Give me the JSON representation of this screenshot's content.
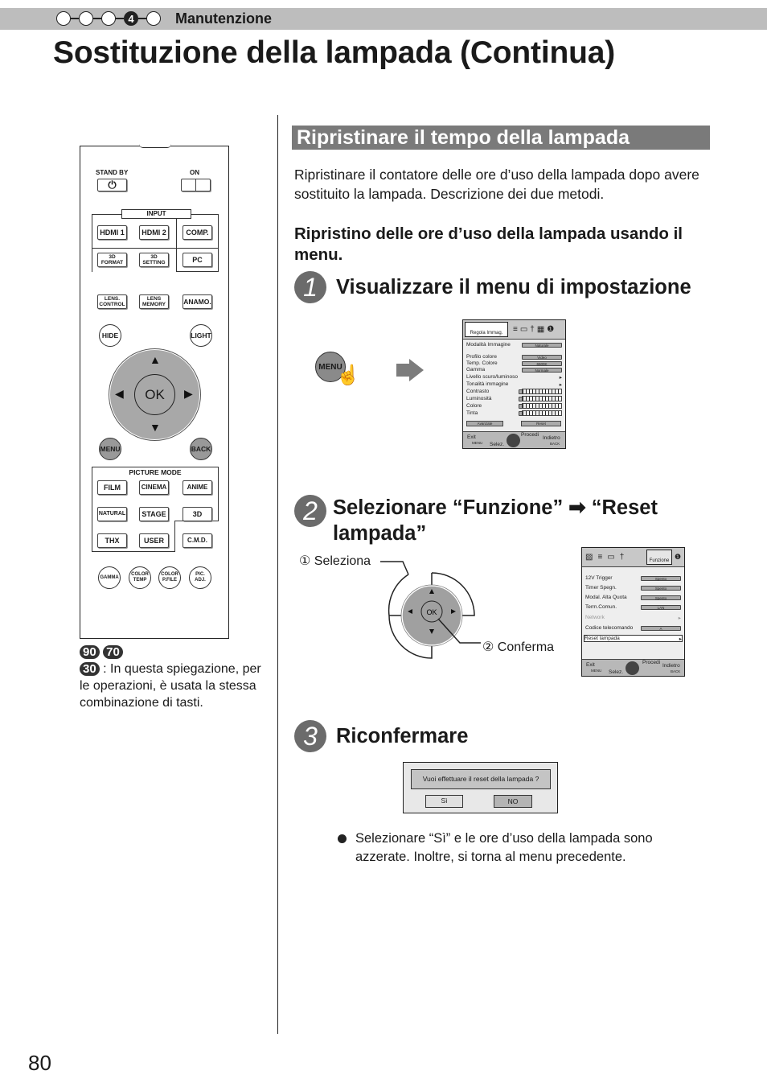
{
  "header": {
    "section_label": "Manutenzione",
    "step_indicator": {
      "total": 5,
      "current": 4,
      "current_label": "4"
    },
    "title": "Sostituzione della lampada (Continua)"
  },
  "page_number": "80",
  "remote": {
    "standby_label": "STAND BY",
    "on_label": "ON",
    "input_group_label": "INPUT",
    "input_buttons": [
      "HDMI 1",
      "HDMI 2",
      "COMP.",
      "PC"
    ],
    "format_buttons": [
      "3D FORMAT",
      "3D SETTING"
    ],
    "lens_buttons": [
      "LENS. CONTROL",
      "LENS MEMORY",
      "ANAMO."
    ],
    "hide_label": "HIDE",
    "light_label": "LIGHT",
    "ok_label": "OK",
    "menu_label": "MENU",
    "back_label": "BACK",
    "picture_mode_label": "PICTURE MODE",
    "picture_mode_buttons": [
      "FILM",
      "CINEMA",
      "ANIME",
      "NATURAL",
      "STAGE",
      "3D",
      "THX",
      "USER"
    ],
    "cmd_label": "C.M.D.",
    "bottom_buttons": [
      "GAMMA",
      "COLOR TEMP",
      "COLOR P.FILE",
      "PIC. ADJ."
    ]
  },
  "model_note": {
    "badges": [
      "90",
      "70",
      "30"
    ],
    "text": ": In questa spiegazione, per le operazioni, è usata la stessa combinazione di tasti."
  },
  "main": {
    "heading": "Ripristinare il tempo della lampada",
    "intro": "Ripristinare il contatore delle ore d’uso della lampada dopo avere sostituito la lampada. Descrizione dei due metodi.",
    "subheading": "Ripristino delle ore d’uso della lampada usando il menu.",
    "steps": [
      {
        "num": "1",
        "title": "Visualizzare il menu di impostazione"
      },
      {
        "num": "2",
        "title": "Selezionare “Funzione” ➡ “Reset lampada”"
      },
      {
        "num": "3",
        "title": "Riconfermare"
      }
    ],
    "menu_button_label": "MENU",
    "osd1": {
      "tab_label": "Regola Immag.",
      "rows": [
        {
          "label": "Modalità Immagine",
          "value": "Naturale"
        },
        {
          "label": "Profilo colore",
          "value": "Video"
        },
        {
          "label": "Temp. Colore",
          "value": "6500K"
        },
        {
          "label": "Gamma",
          "value": "Normale"
        },
        {
          "label": "Livello scuro/luminoso",
          "value": "▸"
        },
        {
          "label": "Tonalità immagine",
          "value": "▸"
        },
        {
          "label": "Contrasto",
          "value": "0"
        },
        {
          "label": "Luminosità",
          "value": "0"
        },
        {
          "label": "Colore",
          "value": "0"
        },
        {
          "label": "Tinta",
          "value": "0"
        }
      ],
      "advanced_label": "Avanzate",
      "reset_label": "Reset",
      "footer": {
        "exit": "Exit",
        "exit_key": "MENU",
        "select": "Selez.",
        "proceed": "Procedi",
        "back": "Indietro",
        "back_key": "BACK"
      }
    },
    "dpad_labels": {
      "select": "① Seleziona",
      "confirm": "② Conferma",
      "ok": "OK"
    },
    "osd2": {
      "tab_label": "Funzione",
      "rows": [
        {
          "label": "12V Trigger",
          "value": "Spento"
        },
        {
          "label": "Timer Spegn.",
          "value": "Spento"
        },
        {
          "label": "Modal. Alta Quota",
          "value": "Spento"
        },
        {
          "label": "Term.Comun.",
          "value": "LAN"
        },
        {
          "label": "Network",
          "value": "▸"
        },
        {
          "label": "Codice telecomando",
          "value": "A"
        },
        {
          "label": "Reset lampada",
          "value": "▸"
        }
      ],
      "footer": {
        "exit": "Exit",
        "exit_key": "MENU",
        "select": "Selez.",
        "proceed": "Procedi",
        "back": "Indietro",
        "back_key": "BACK"
      }
    },
    "dialog": {
      "question": "Vuoi effettuare il reset della lampada ?",
      "yes": "Sì",
      "no": "NO"
    },
    "bullet": "Selezionare “Sì” e le ore d’uso della lampada sono azzerate. Inoltre, si torna al menu precedente."
  }
}
